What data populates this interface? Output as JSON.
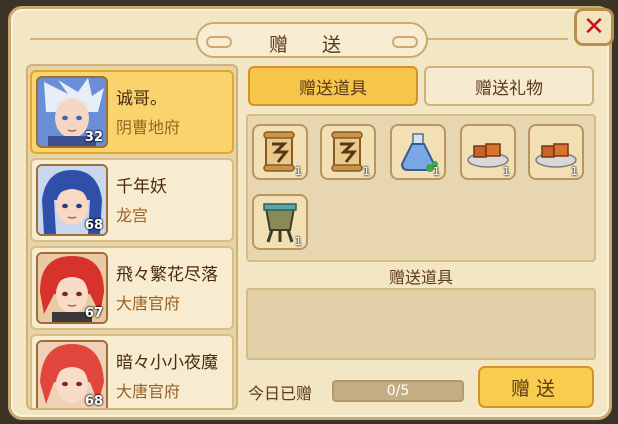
{
  "dialog": {
    "title": "赠 送",
    "close_icon": "close-x-icon"
  },
  "tabs": [
    {
      "label": "赠送道具",
      "active": true
    },
    {
      "label": "赠送礼物",
      "active": false
    }
  ],
  "friends": [
    {
      "name": "诚哥。",
      "group": "阴曹地府",
      "level": "32",
      "selected": true
    },
    {
      "name": "千年妖",
      "group": "龙宫",
      "level": "68",
      "selected": false
    },
    {
      "name": "飛々繁花尽落",
      "group": "大唐官府",
      "level": "67",
      "selected": false
    },
    {
      "name": "暗々小小夜魔",
      "group": "大唐官府",
      "level": "68",
      "selected": false
    }
  ],
  "items": [
    {
      "icon": "scroll-icon",
      "count": "1"
    },
    {
      "icon": "scroll-icon",
      "count": "1"
    },
    {
      "icon": "potion-bottle-icon",
      "count": "1"
    },
    {
      "icon": "cake-plate-icon",
      "count": "1"
    },
    {
      "icon": "cake-plate-icon",
      "count": "1"
    },
    {
      "icon": "bronze-vessel-icon",
      "count": "1"
    }
  ],
  "gift_section": {
    "label": "赠送道具"
  },
  "today": {
    "label": "今日已赠",
    "progress_text": "0/5",
    "given": 0,
    "limit": 5
  },
  "give_button": {
    "label": "赠送"
  },
  "colors": {
    "accent": "#f6c64a",
    "panel": "#f3e6c4",
    "close": "#c8141b"
  }
}
